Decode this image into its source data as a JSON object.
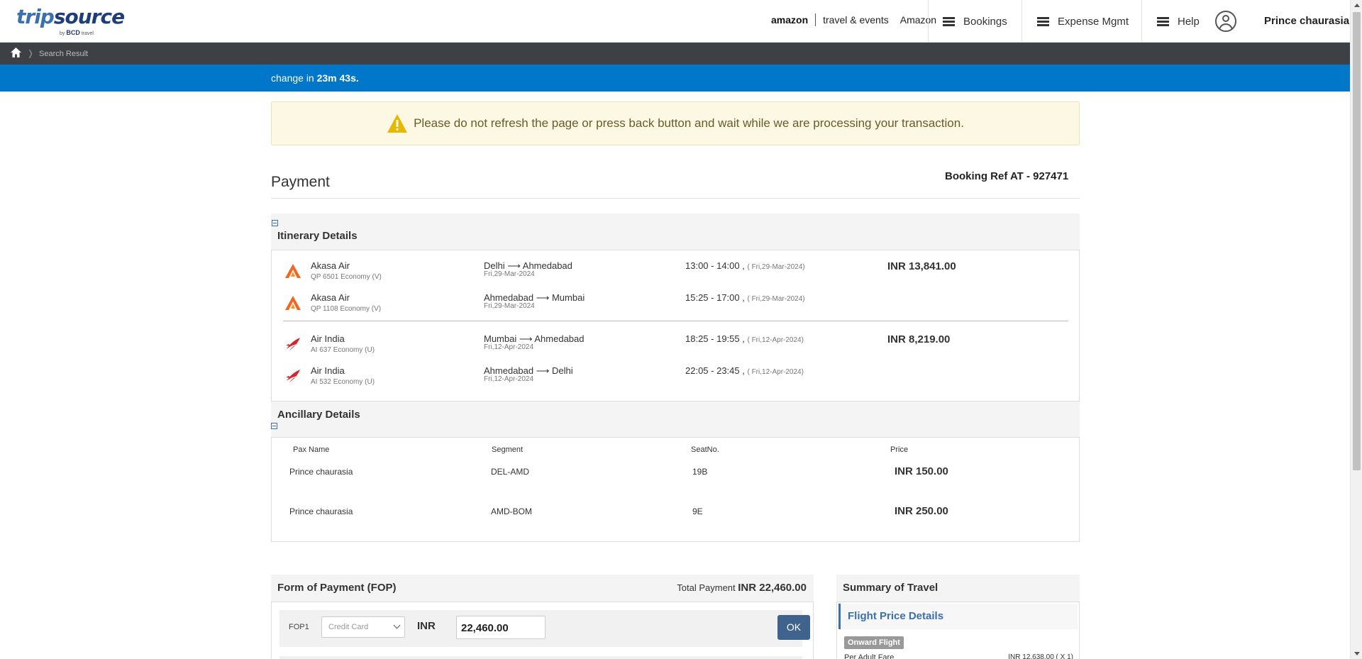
{
  "header": {
    "logo_main": "trip",
    "logo_main2": "source",
    "logo_by": "by",
    "logo_bcd": "BCD",
    "logo_travel": "travel",
    "amazon_word": "amazon",
    "amazon_tagline": "travel & events",
    "company": "Amazon",
    "nav": {
      "bookings": "Bookings",
      "expense": "Expense Mgmt",
      "help": "Help"
    },
    "user_name": "Prince chaurasia"
  },
  "breadcrumb": {
    "current": "Search Result"
  },
  "timer": {
    "prefix": "change in",
    "time": "23m 43s."
  },
  "warning": {
    "text": "Please do not refresh the page or press back button and wait while we are processing your transaction."
  },
  "payment": {
    "title": "Payment",
    "booking_ref": "Booking Ref AT - 927471"
  },
  "itinerary": {
    "title": "Itinerary Details",
    "flights": [
      {
        "airline": "Akasa Air",
        "sub": "QP 6501 Economy (V)",
        "route": "Delhi ⟶ Ahmedabad",
        "date": "Fri,29-Mar-2024",
        "time": "13:00 - 14:00 ,",
        "time_date": "( Fri,29-Mar-2024)",
        "price": "INR 13,841.00",
        "brand_color": "#f26522"
      },
      {
        "airline": "Akasa Air",
        "sub": "QP 1108 Economy (V)",
        "route": "Ahmedabad ⟶ Mumbai",
        "date": "Fri,29-Mar-2024",
        "time": "15:25 - 17:00 ,",
        "time_date": "( Fri,29-Mar-2024)",
        "price": "",
        "brand_color": "#f26522"
      },
      {
        "airline": "Air India",
        "sub": "AI 637 Economy (U)",
        "route": "Mumbai ⟶ Ahmedabad",
        "date": "Fri,12-Apr-2024",
        "time": "18:25 - 19:55 ,",
        "time_date": "( Fri,12-Apr-2024)",
        "price": "INR 8,219.00",
        "brand_color": "#d7262a"
      },
      {
        "airline": "Air India",
        "sub": "AI 532 Economy (U)",
        "route": "Ahmedabad ⟶ Delhi",
        "date": "Fri,12-Apr-2024",
        "time": "22:05 - 23:45 ,",
        "time_date": "( Fri,12-Apr-2024)",
        "price": "",
        "brand_color": "#d7262a"
      }
    ]
  },
  "ancillary": {
    "title": "Ancillary Details",
    "headers": {
      "pax": "Pax Name",
      "segment": "Segment",
      "seat": "SeatNo.",
      "price": "Price"
    },
    "rows": [
      {
        "pax": "Prince chaurasia",
        "segment": "DEL-AMD",
        "seat": "19B",
        "price": "INR 150.00"
      },
      {
        "pax": "Prince chaurasia",
        "segment": "AMD-BOM",
        "seat": "9E",
        "price": "INR 250.00"
      }
    ]
  },
  "fop": {
    "title": "Form of Payment (FOP)",
    "total_label": "Total Payment",
    "total_value": "INR 22,460.00",
    "label": "FOP1",
    "method_placeholder": "Credit Card",
    "currency": "INR",
    "amount": "22,460.00",
    "ok": "OK"
  },
  "summary": {
    "title": "Summary of Travel",
    "flight_price_details": "Flight Price Details",
    "onward_badge": "Onward Flight",
    "per_adult_label": "Per Adult Fare",
    "per_adult_value": "INR 12,638.00 ( X 1)"
  },
  "colors": {
    "accent": "#0077c8",
    "brand_blue": "#3a6fb0",
    "ok_button": "#3f638c"
  }
}
